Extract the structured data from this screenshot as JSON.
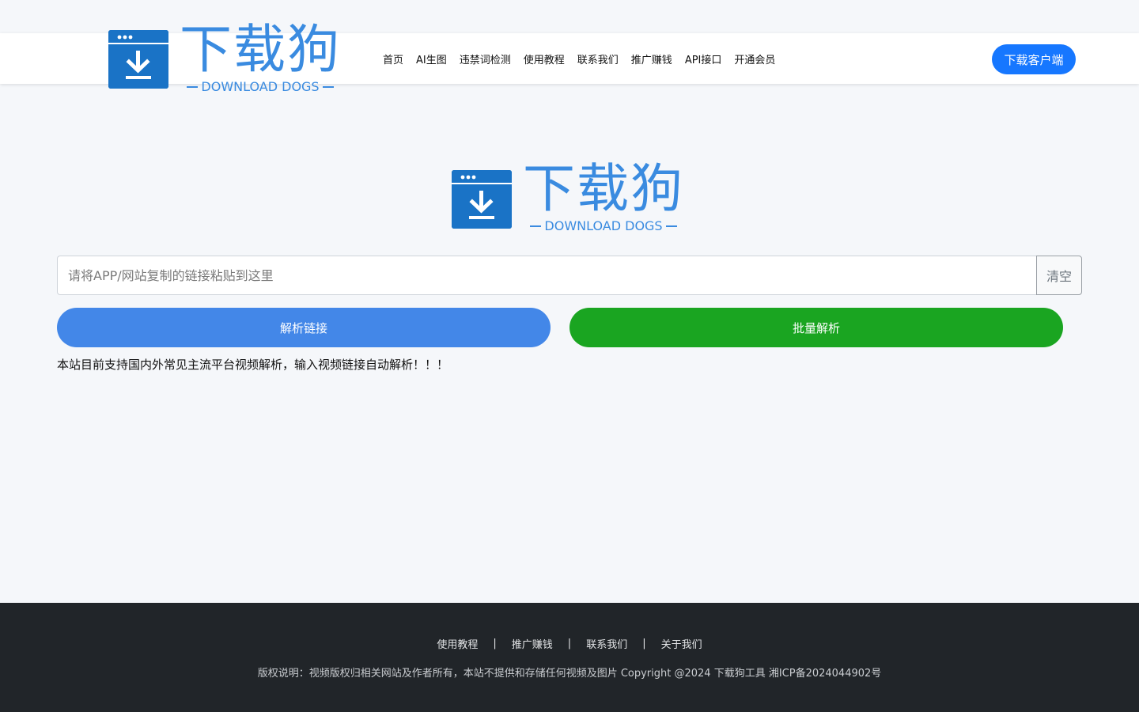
{
  "header": {
    "logo": {
      "cn": "下载狗",
      "en": "DOWNLOAD DOGS"
    },
    "nav": [
      {
        "label": "首页"
      },
      {
        "label": "AI生图"
      },
      {
        "label": "违禁词检测"
      },
      {
        "label": "使用教程"
      },
      {
        "label": "联系我们"
      },
      {
        "label": "推广赚钱"
      },
      {
        "label": "API接口"
      },
      {
        "label": "开通会员"
      }
    ],
    "client_button": "下载客户端"
  },
  "main": {
    "logo": {
      "cn": "下载狗",
      "en": "DOWNLOAD DOGS"
    },
    "url_input": {
      "placeholder": "请将APP/网站复制的链接粘贴到这里",
      "value": ""
    },
    "clear_button": "清空",
    "parse_button": "解析链接",
    "batch_button": "批量解析",
    "notice": "本站目前支持国内外常见主流平台视频解析，输入视频链接自动解析！！！"
  },
  "footer": {
    "links": [
      {
        "label": "使用教程"
      },
      {
        "label": "推广赚钱"
      },
      {
        "label": "联系我们"
      },
      {
        "label": "关于我们"
      }
    ],
    "separator": "|",
    "copyright": "版权说明：视频版权归相关网站及作者所有，本站不提供和存储任何视频及图片 Copyright @2024 下载狗工具 湘ICP备2024044902号"
  },
  "colors": {
    "brand_blue": "#3a8be0",
    "primary": "#1677ff",
    "parse": "#4387e8",
    "batch": "#1aa521",
    "footer_bg": "#212529"
  }
}
